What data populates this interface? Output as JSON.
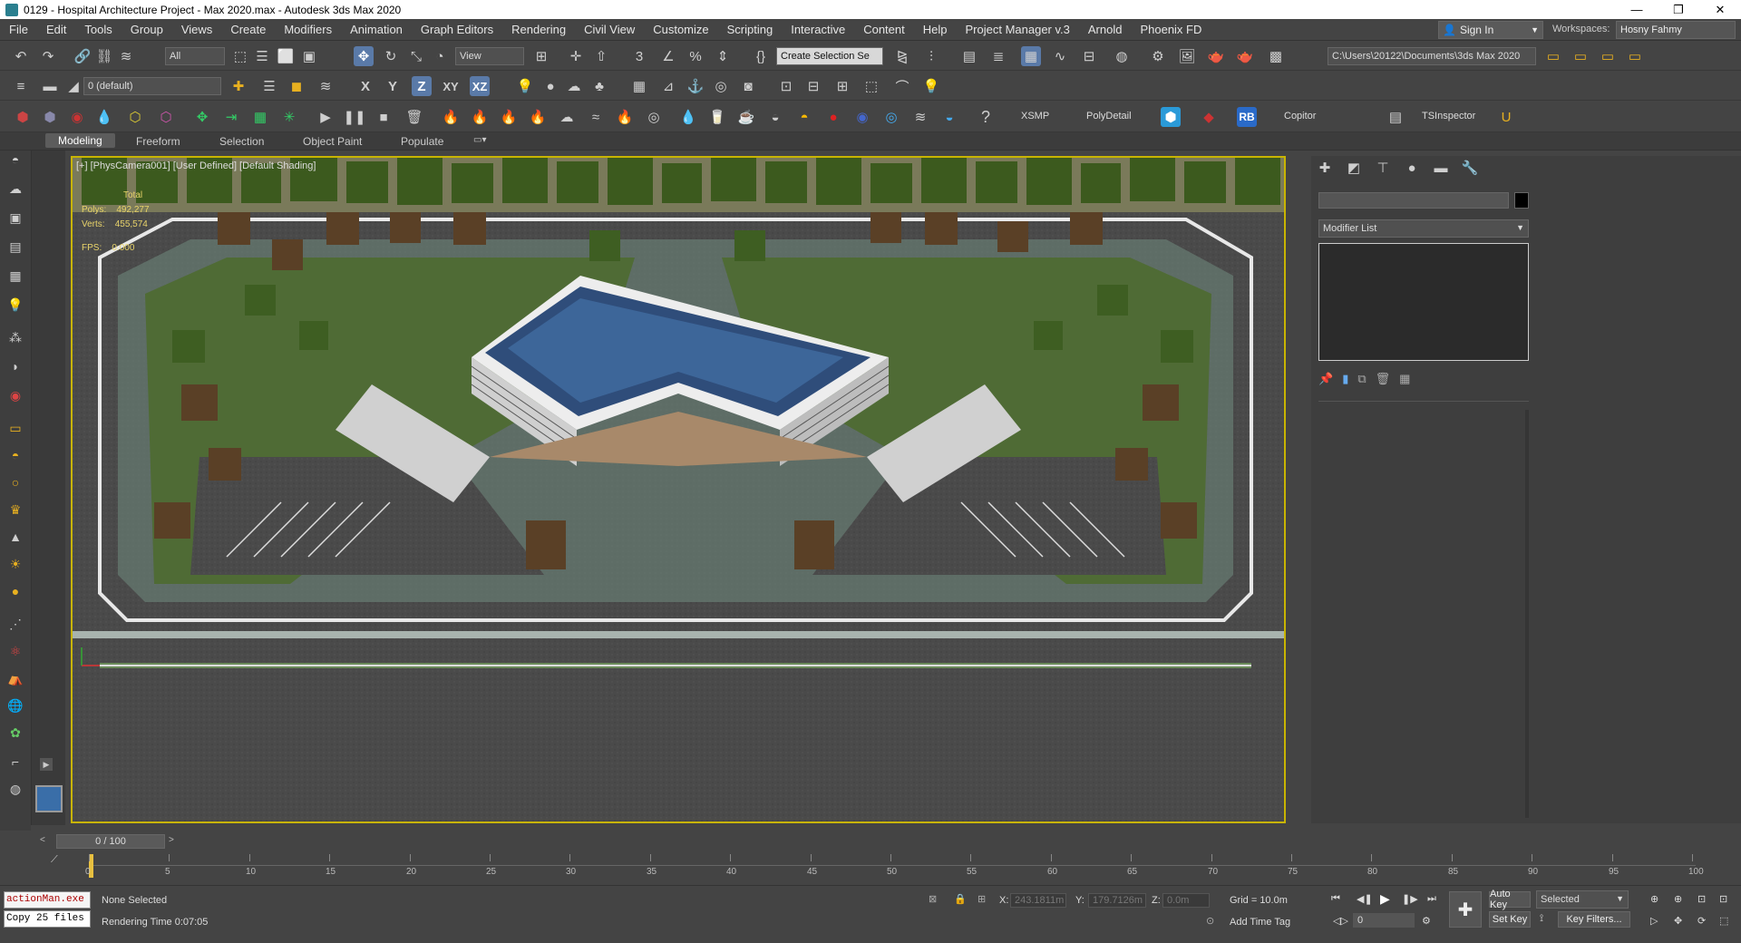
{
  "titlebar": {
    "title": "0129 - Hospital Architecture Project - Max 2020.max - Autodesk 3ds Max 2020",
    "minimize": "—",
    "maximize": "❐",
    "close": "✕"
  },
  "menu": [
    "File",
    "Edit",
    "Tools",
    "Group",
    "Views",
    "Create",
    "Modifiers",
    "Animation",
    "Graph Editors",
    "Rendering",
    "Civil View",
    "Customize",
    "Scripting",
    "Interactive",
    "Content",
    "Help",
    "Project Manager v.3",
    "Arnold",
    "Phoenix FD"
  ],
  "account": {
    "sign_in": "Sign In",
    "workspaces_label": "Workspaces:",
    "workspace_value": "Hosny Fahmy"
  },
  "toolbar1": {
    "filter_value": "All",
    "ref_coord": "View",
    "selection_set": "Create Selection Se",
    "project_path": "C:\\Users\\20122\\Documents\\3ds Max 2020"
  },
  "toolbar2": {
    "layer_value": "0 (default)",
    "axis_x": "X",
    "axis_y": "Y",
    "axis_z": "Z",
    "axis_xy": "XY",
    "axis_xz": "XZ"
  },
  "toolbar3": {
    "xsmp": "XSMP",
    "polydetail": "PolyDetail",
    "rb": "RB",
    "copitor": "Copitor",
    "tsinspector": "TSInspector"
  },
  "ribbon_tabs": [
    "Modeling",
    "Freeform",
    "Selection",
    "Object Paint",
    "Populate"
  ],
  "viewport": {
    "label": "[+] [PhysCamera001] [User Defined] [Default Shading]",
    "stats_total": "Total",
    "polys_label": "Polys:",
    "polys_value": "492,277",
    "verts_label": "Verts:",
    "verts_value": "455,574",
    "fps_label": "FPS:",
    "fps_value": "0.000"
  },
  "command_panel": {
    "modifier_list": "Modifier List"
  },
  "timeline": {
    "frame_counter": "0 / 100",
    "ticks": [
      "0",
      "5",
      "10",
      "15",
      "20",
      "25",
      "30",
      "35",
      "40",
      "45",
      "50",
      "55",
      "60",
      "65",
      "70",
      "75",
      "80",
      "85",
      "90",
      "95",
      "100"
    ]
  },
  "statusbar": {
    "maxscript_line1": "actionMan.exe",
    "maxscript_line2": "Copy 25 files",
    "selection_status": "None Selected",
    "render_time": "Rendering Time  0:07:05",
    "x_label": "X:",
    "x_value": "243.1811m",
    "y_label": "Y:",
    "y_value": "179.7126m",
    "z_label": "Z:",
    "z_value": "0.0m",
    "grid": "Grid = 10.0m",
    "add_time_tag": "Add Time Tag",
    "auto_key": "Auto Key",
    "selected": "Selected",
    "set_key": "Set Key",
    "key_filters": "Key Filters...",
    "frame_value": "0"
  }
}
